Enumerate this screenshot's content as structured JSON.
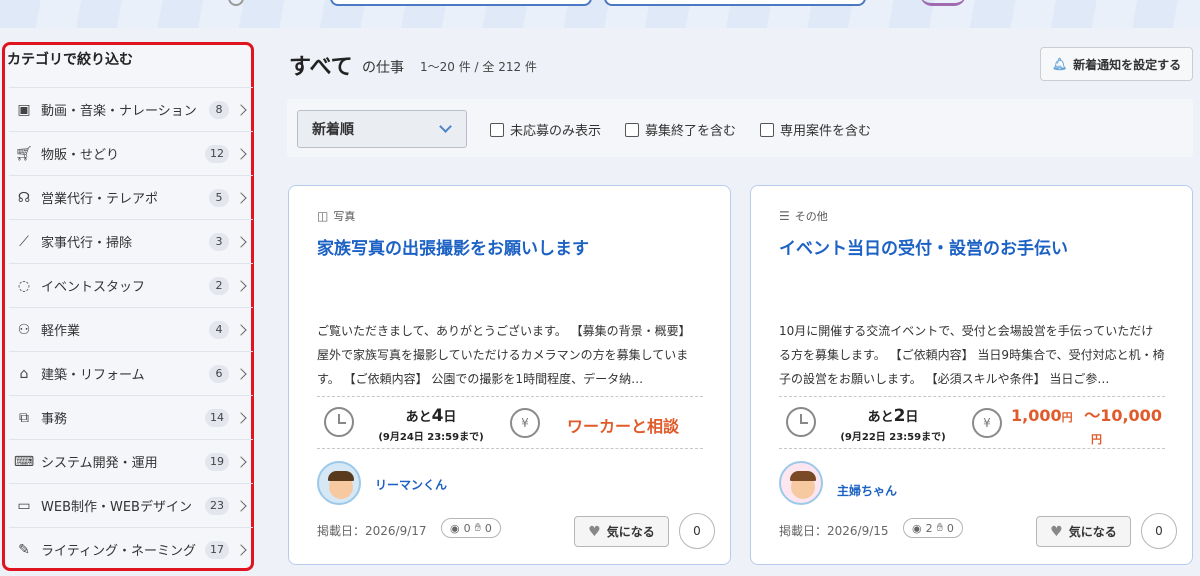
{
  "sidebar": {
    "title": "カテゴリで絞り込む",
    "items": [
      {
        "label": "動画・音楽・ナレーション",
        "count": "8",
        "icon": "video-icon"
      },
      {
        "label": "物販・せどり",
        "count": "12",
        "icon": "cart-icon"
      },
      {
        "label": "営業代行・テレアポ",
        "count": "5",
        "icon": "headset-icon"
      },
      {
        "label": "家事代行・掃除",
        "count": "3",
        "icon": "broom-icon"
      },
      {
        "label": "イベントスタッフ",
        "count": "2",
        "icon": "lightbulb-icon"
      },
      {
        "label": "軽作業",
        "count": "4",
        "icon": "people-icon"
      },
      {
        "label": "建築・リフォーム",
        "count": "6",
        "icon": "house-icon"
      },
      {
        "label": "事務",
        "count": "14",
        "icon": "office-icon"
      },
      {
        "label": "システム開発・運用",
        "count": "19",
        "icon": "laptop-icon"
      },
      {
        "label": "WEB制作・WEBデザイン",
        "count": "23",
        "icon": "browser-window-icon"
      },
      {
        "label": "ライティング・ネーミング",
        "count": "17",
        "icon": "edit-icon"
      }
    ]
  },
  "header": {
    "title": "すべて",
    "subtitle": "の仕事",
    "count_info": "1〜20 件 / 全 212 件",
    "notify_button": "新着通知を設定する"
  },
  "filters": {
    "sort_value": "新着順",
    "checkboxes": [
      "未応募のみ表示",
      "募集終了を含む",
      "専用案件を含む"
    ]
  },
  "jobs": [
    {
      "category": "写真",
      "category_icon": "camera-icon",
      "title": "家族写真の出張撮影をお願いします",
      "description": "ご覧いただきまして、ありがとうございます。 【募集の背景・概要】 屋外で家族写真を撮影していただけるカメラマンの方を募集しています。 【ご依頼内容】 公園での撮影を1時間程度、データ納…",
      "deadline_prefix": "あと",
      "deadline_days": "4",
      "deadline_suffix": "日",
      "deadline_date": "(9月24日 23:59まで)",
      "price": "ワーカーと相談",
      "username": "リーマンくん",
      "posted": "掲載日：2026/9/17",
      "views": "0",
      "applicants": "0",
      "fav_label": "気になる",
      "fav_count": "0"
    },
    {
      "category": "その他",
      "category_icon": "list-icon",
      "title": "イベント当日の受付・設営のお手伝い",
      "description": "10月に開催する交流イベントで、受付と会場設営を手伝っていただける方を募集します。 【ご依頼内容】 当日9時集合で、受付対応と机・椅子の設営をお願いします。 【必須スキルや条件】 当日ご参…",
      "deadline_prefix": "あと",
      "deadline_days": "2",
      "deadline_suffix": "日",
      "deadline_date": "(9月22日 23:59まで)",
      "price_min": "1,000",
      "price_unit": "円",
      "price_sep": "〜",
      "price_max": "10,000",
      "username": "主婦ちゃん",
      "posted": "掲載日：2026/9/15",
      "views": "2",
      "applicants": "0",
      "fav_label": "気になる",
      "fav_count": "0"
    }
  ],
  "colors": {
    "highlight_border": "#e0141e",
    "link_blue": "#1c61c4",
    "price_orange": "#e05a2a"
  }
}
